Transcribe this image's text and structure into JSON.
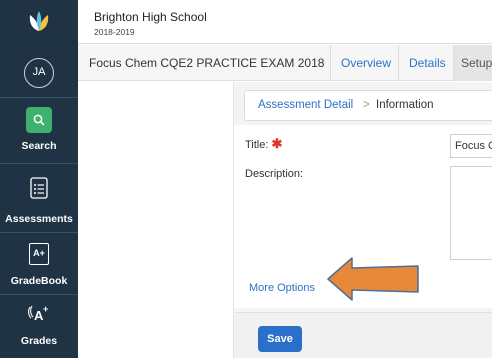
{
  "sidebar": {
    "avatar_initials": "JA",
    "items": [
      {
        "label": "Search",
        "icon": "search-icon"
      },
      {
        "label": "Assessments",
        "icon": "assessments-icon"
      },
      {
        "label": "GradeBook",
        "icon": "gradebook-icon"
      },
      {
        "label": "Grades",
        "icon": "grades-icon"
      }
    ],
    "gradebook_glyph": "A+"
  },
  "header": {
    "school_name": "Brighton High School",
    "school_year": "2018-2019"
  },
  "tabs": {
    "exam_title": "Focus Chem CQE2 PRACTICE EXAM 2018",
    "items": [
      "Overview",
      "Details",
      "Setup"
    ]
  },
  "breadcrumb": {
    "link": "Assessment Detail",
    "separator": ">",
    "current": "Information"
  },
  "form": {
    "title_label": "Title:",
    "required_mark": "✱",
    "title_value": "Focus C",
    "description_label": "Description:",
    "more_options": "More Options",
    "save_label": "Save"
  },
  "colors": {
    "sidebar_bg": "#1f3345",
    "accent_green": "#3db26f",
    "link_blue": "#2d73c4",
    "save_blue": "#2a6fc9",
    "arrow_orange": "#e8883a"
  }
}
